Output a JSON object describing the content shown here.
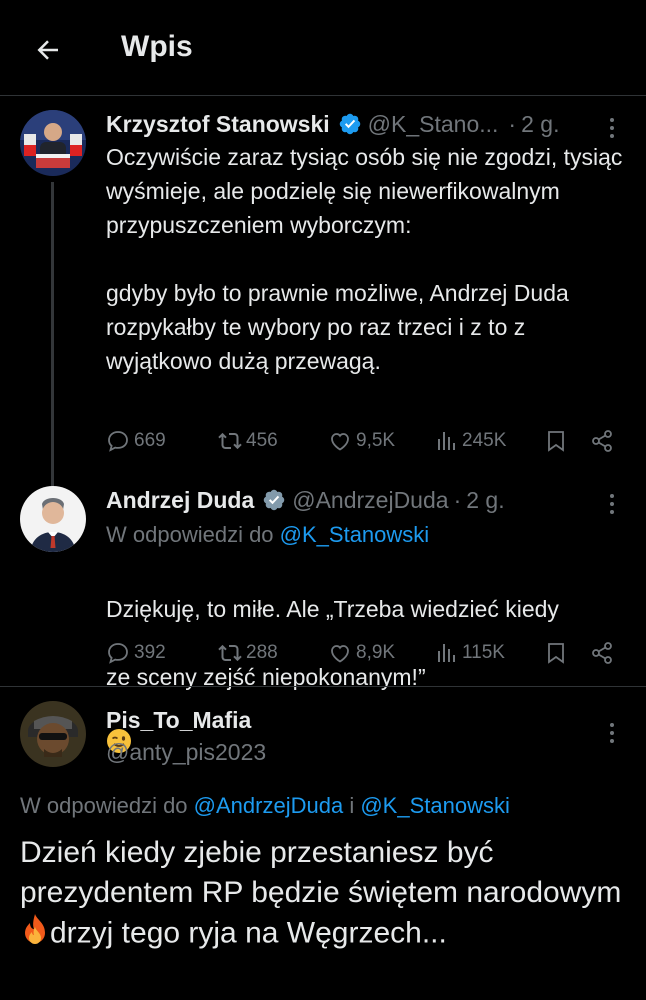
{
  "header": {
    "title": "Wpis"
  },
  "tweets": [
    {
      "name": "Krzysztof Stanowski",
      "handle": "@K_Stano...",
      "dot": "·",
      "time": "2 g.",
      "text": "Oczywiście zaraz tysiąc osób się nie zgodzi, tysiąc wyśmieje, ale podzielę się niewerfikowalnym przypuszczeniem wyborczym:\n\ngdyby było to prawnie możliwe, Andrzej Duda rozpykałby te wybory po raz trzeci i z to z wyjątkowo dużą przewagą.",
      "stats": {
        "replies": "669",
        "reposts": "456",
        "likes": "9,5K",
        "views": "245K"
      }
    },
    {
      "name": "Andrzej Duda",
      "handle": "@AndrzejDuda",
      "dot": "·",
      "time": "2 g.",
      "reply_prefix": "W odpowiedzi do",
      "reply_target": "@K_Stanowski",
      "text_line1": "Dziękuję, to miłe. Ale „Trzeba wiedzieć kiedy",
      "text_line2": "ze sceny zejść niepokonanym!”",
      "emoji": "wink-emoji",
      "stats": {
        "replies": "392",
        "reposts": "288",
        "likes": "8,9K",
        "views": "115K"
      }
    },
    {
      "name": "Pis_To_Mafia",
      "handle": "@anty_pis2023",
      "reply_prefix": "W odpowiedzi do",
      "reply_target1": "@AndrzejDuda",
      "reply_and": "i",
      "reply_target2": "@K_Stanowski",
      "text_part1": "Dzień kiedy zjebie przestaniesz być prezydentem RP będzie świętem narodowym ",
      "emoji": "fire-emoji",
      "text_part2": "drzyj tego ryja na Węgrzech..."
    }
  ],
  "colors": {
    "accent": "#1d9bf0",
    "muted": "#71767b",
    "text": "#e7e9ea",
    "background": "#000000"
  }
}
